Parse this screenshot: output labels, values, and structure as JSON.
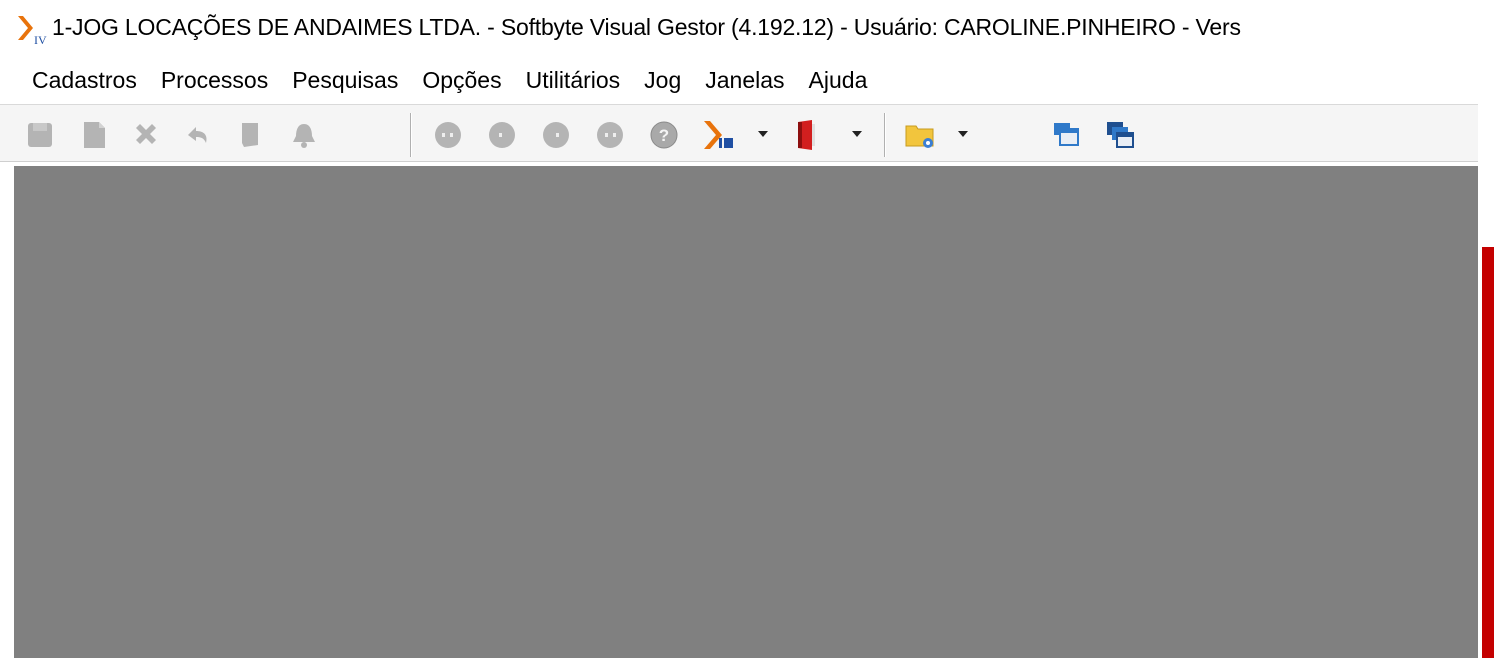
{
  "window": {
    "title": "1-JOG LOCAÇÕES DE ANDAIMES LTDA.  -  Softbyte Visual Gestor (4.192.12) - Usuário: CAROLINE.PINHEIRO - Vers",
    "logo_subscript": "IV"
  },
  "menu": {
    "items": [
      "Cadastros",
      "Processos",
      "Pesquisas",
      "Opções",
      "Utilitários",
      "Jog",
      "Janelas",
      "Ajuda"
    ]
  },
  "toolbar": {
    "buttons": [
      {
        "name": "save-icon",
        "enabled": false
      },
      {
        "name": "new-document-icon",
        "enabled": false
      },
      {
        "name": "delete-icon",
        "enabled": false
      },
      {
        "name": "undo-icon",
        "enabled": false
      },
      {
        "name": "print-icon",
        "enabled": false
      },
      {
        "name": "alarm-bell-icon",
        "enabled": false
      },
      {
        "name": "first-record-icon",
        "enabled": false
      },
      {
        "name": "previous-record-icon",
        "enabled": false
      },
      {
        "name": "next-record-icon",
        "enabled": false
      },
      {
        "name": "last-record-icon",
        "enabled": false
      },
      {
        "name": "help-icon",
        "enabled": false
      },
      {
        "name": "visual-gestor-icon",
        "enabled": true
      },
      {
        "name": "exit-door-icon",
        "enabled": true
      },
      {
        "name": "folder-icon",
        "enabled": true
      },
      {
        "name": "cascade-windows-icon",
        "enabled": true
      },
      {
        "name": "tile-windows-icon",
        "enabled": true
      }
    ]
  },
  "colors": {
    "mdi_background": "#808080",
    "accent_red": "#c40000",
    "logo_orange": "#e8730c",
    "logo_blue": "#1f4fa3"
  }
}
